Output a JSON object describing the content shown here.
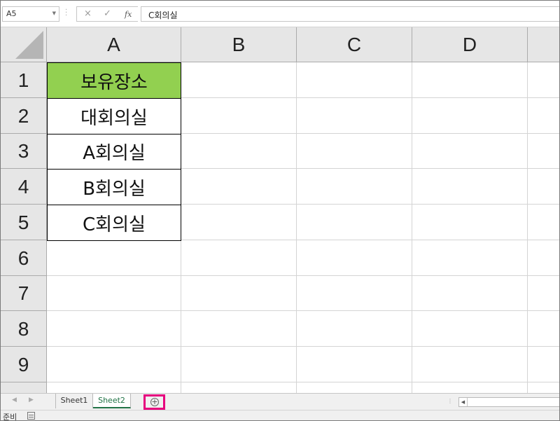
{
  "formula_bar": {
    "name_box": "A5",
    "cancel_glyph": "×",
    "enter_glyph": "✓",
    "fx_label": "fx",
    "content": "C회의실"
  },
  "columns": [
    "A",
    "B",
    "C",
    "D"
  ],
  "rows": [
    "1",
    "2",
    "3",
    "4",
    "5",
    "6",
    "7",
    "8",
    "9"
  ],
  "cells": {
    "A1": "보유장소",
    "A2": "대회의실",
    "A3": "A회의실",
    "A4": "B회의실",
    "A5": "C회의실"
  },
  "colors": {
    "header_fill": "#92d050",
    "active_tab": "#217346",
    "highlight": "#e6007e"
  },
  "sheet_tabs": [
    "Sheet1",
    "Sheet2"
  ],
  "active_sheet": "Sheet2",
  "add_sheet_glyph": "+",
  "status": {
    "ready": "준비"
  }
}
